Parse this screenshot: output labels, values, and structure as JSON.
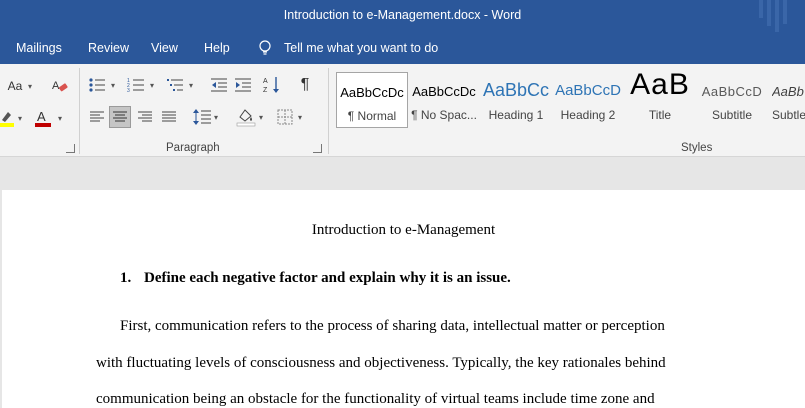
{
  "titlebar": {
    "title": "Introduction to e-Management.docx  -  Word"
  },
  "menu": {
    "tabs": [
      "Mailings",
      "Review",
      "View",
      "Help"
    ],
    "tell_me": "Tell me what you want to do"
  },
  "ribbon": {
    "font": {
      "change_case": "Aa"
    },
    "paragraph": {
      "label": "Paragraph"
    },
    "styles": {
      "label": "Styles",
      "items": [
        {
          "sample": "AaBbCcDc",
          "name": "¶ Normal",
          "active": true
        },
        {
          "sample": "AaBbCcDc",
          "name": "¶ No Spac..."
        },
        {
          "sample": "AaBbCc",
          "name": "Heading 1"
        },
        {
          "sample": "AaBbCcD",
          "name": "Heading 2"
        },
        {
          "sample": "AaB",
          "name": "Title"
        },
        {
          "sample": "AaBbCcD",
          "name": "Subtitle"
        },
        {
          "sample": "AaBb",
          "name": "Subtle"
        }
      ],
      "colors": {
        "heading": "#2e74b5",
        "normal": "#000000",
        "subtitle": "#595959"
      }
    }
  },
  "document": {
    "title": "Introduction to e-Management",
    "question_number": "1.",
    "question": "Define each negative factor and explain why it is an issue.",
    "lines": [
      "First, communication refers to the process of sharing data, intellectual matter or perception",
      "with fluctuating levels of consciousness and objectiveness. Typically, the key rationales behind",
      "communication being an obstacle for the functionality of virtual teams include time zone and"
    ]
  },
  "colors": {
    "brand": "#2b579a",
    "ribbon_bg": "#f3f3f3",
    "canvas_bg": "#e6e6e6"
  }
}
